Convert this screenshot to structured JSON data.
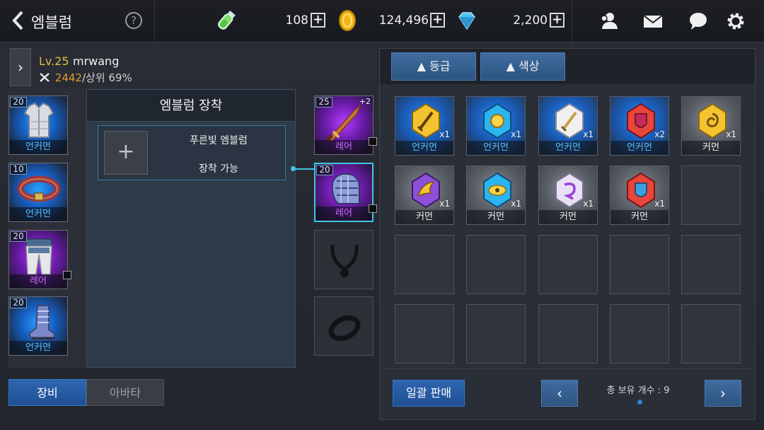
{
  "header": {
    "title": "엠블럼",
    "help_label": "?",
    "currencies": [
      {
        "name": "stamina",
        "icon": "vial-icon",
        "value": "108"
      },
      {
        "name": "gold",
        "icon": "gold-coin-icon",
        "value": "124,496"
      },
      {
        "name": "gem",
        "icon": "diamond-icon",
        "value": "2,200"
      }
    ],
    "plus_label": "+",
    "icons": [
      "friends-icon",
      "mail-icon",
      "chat-icon",
      "settings-icon"
    ]
  },
  "character": {
    "level": "Lv.25",
    "name": "mrwang",
    "power": "2442",
    "rank": "/상위 69%"
  },
  "equipment_left": [
    {
      "slot": "armor",
      "icon": "chest-armor-icon",
      "level": "20",
      "grade": "언커먼",
      "grade_type": "uncommon"
    },
    {
      "slot": "belt",
      "icon": "belt-icon",
      "level": "10",
      "grade": "언커먼",
      "grade_type": "uncommon"
    },
    {
      "slot": "pants",
      "icon": "pants-icon",
      "level": "20",
      "grade": "레어",
      "grade_type": "rare"
    },
    {
      "slot": "boots",
      "icon": "boots-icon",
      "level": "20",
      "grade": "언커먼",
      "grade_type": "uncommon"
    }
  ],
  "equipment_right": [
    {
      "slot": "weapon",
      "icon": "sword-icon",
      "level": "25",
      "enhance": "+2",
      "grade": "레어",
      "grade_type": "rare"
    },
    {
      "slot": "gloves",
      "icon": "gauntlet-icon",
      "level": "20",
      "grade": "레어",
      "grade_type": "rare"
    }
  ],
  "emblem": {
    "header": "엠블럼 장착",
    "add_label": "+",
    "slot_name": "푸른빛 엠블럼",
    "slot_status": "장착 가능"
  },
  "tabs": {
    "equip": "장비",
    "avatar": "아바타"
  },
  "inventory": {
    "sort_grade": "▲ 등급",
    "sort_color": "▲ 색상",
    "items": [
      {
        "icon": "yellow-sword-gem-icon",
        "qty": "x1",
        "grade": "언커먼",
        "grade_type": "uncommon",
        "color": "#f4c430"
      },
      {
        "icon": "blue-sun-gem-icon",
        "qty": "x1",
        "grade": "언커먼",
        "grade_type": "uncommon",
        "color": "#2ab5f0"
      },
      {
        "icon": "white-sword-gem-icon",
        "qty": "x1",
        "grade": "언커먼",
        "grade_type": "uncommon",
        "color": "#f0f0f0"
      },
      {
        "icon": "red-shield-gem-icon",
        "qty": "x2",
        "grade": "언커먼",
        "grade_type": "uncommon",
        "color": "#e8453c"
      },
      {
        "icon": "gold-swirl-gem-icon",
        "qty": "x1",
        "grade": "커먼",
        "grade_type": "common",
        "color": "#f4c430"
      },
      {
        "icon": "purple-wing-gem-icon",
        "qty": "x1",
        "grade": "커먼",
        "grade_type": "common",
        "color": "#8e4fd8"
      },
      {
        "icon": "cyan-eye-gem-icon",
        "qty": "x1",
        "grade": "커먼",
        "grade_type": "common",
        "color": "#2ab5f0"
      },
      {
        "icon": "white-purple-gem-icon",
        "qty": "x1",
        "grade": "커먼",
        "grade_type": "common",
        "color": "#e8e0f5"
      },
      {
        "icon": "red-shield-gem-icon",
        "qty": "x1",
        "grade": "커먼",
        "grade_type": "common",
        "color": "#e8453c"
      }
    ],
    "bulk_sell": "일괄 판매",
    "total_count": "총 보유 개수 : 9",
    "prev_label": "‹",
    "next_label": "›"
  }
}
